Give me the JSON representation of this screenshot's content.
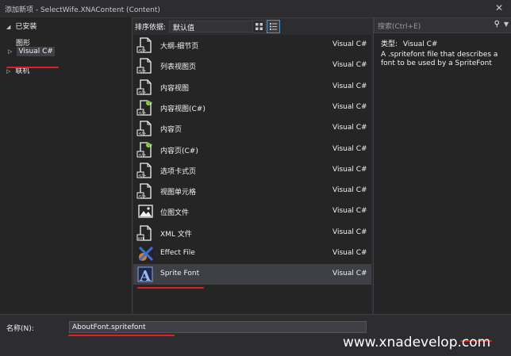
{
  "window": {
    "title": "添加新项 - SelectWife.XNAContent (Content)"
  },
  "left_panel": {
    "installed": "已安装",
    "graphics": "图形",
    "visual_csharp": "Visual C#",
    "online": "联机"
  },
  "toolbar": {
    "sort_label": "排序依据:",
    "sort_value": "默认值"
  },
  "items": [
    {
      "name": "大纲-细节页",
      "type": "Visual C#",
      "icon": "page-icon"
    },
    {
      "name": "列表视图页",
      "type": "Visual C#",
      "icon": "page-icon"
    },
    {
      "name": "内容视图",
      "type": "Visual C#",
      "icon": "page-icon"
    },
    {
      "name": "内容视图(C#)",
      "type": "Visual C#",
      "icon": "page-csharp-icon"
    },
    {
      "name": "内容页",
      "type": "Visual C#",
      "icon": "page-icon"
    },
    {
      "name": "内容页(C#)",
      "type": "Visual C#",
      "icon": "page-csharp-icon"
    },
    {
      "name": "选项卡式页",
      "type": "Visual C#",
      "icon": "page-icon"
    },
    {
      "name": "视图单元格",
      "type": "Visual C#",
      "icon": "page-icon"
    },
    {
      "name": "位图文件",
      "type": "Visual C#",
      "icon": "bitmap-icon"
    },
    {
      "name": "XML 文件",
      "type": "Visual C#",
      "icon": "xml-file-icon"
    },
    {
      "name": "Effect File",
      "type": "Visual C#",
      "icon": "effect-file-icon"
    },
    {
      "name": "Sprite Font",
      "type": "Visual C#",
      "icon": "sprite-font-icon"
    }
  ],
  "selected_index": 11,
  "info_panel": {
    "search_placeholder": "搜索(Ctrl+E)",
    "type_label": "类型:",
    "type_value": "Visual C#",
    "description": "A .spritefont file that describes a font to be used by a SpriteFont"
  },
  "bottom": {
    "name_label": "名称(N):",
    "name_value": "AboutFont.spritefont"
  },
  "watermark": "www.xnadevelop.com"
}
